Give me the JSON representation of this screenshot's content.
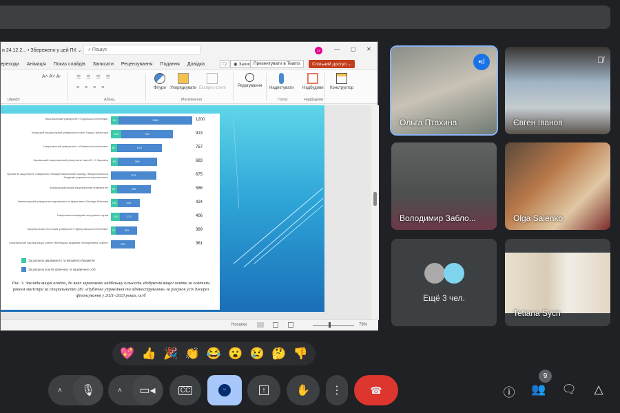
{
  "ppt": {
    "doc_title": "и 24.12.2... • Збережено у цей ПК ⌄",
    "search_placeholder": "Пошук",
    "user_initials": "CP",
    "tabs": [
      "ереходи",
      "Анімація",
      "Показ слайдів",
      "Записати",
      "Рецензування",
      "Подання",
      "Довідка"
    ],
    "record_btn": "◉ Записати",
    "present_teams_btn": "Презентувати в Teams",
    "share_btn": "Спільний доступ ⌄",
    "ribbon": {
      "groups": [
        "Шрифт",
        "Абзац",
        "Малювання",
        "Голос",
        "Надбудови"
      ],
      "buttons": [
        "Фігури",
        "Упорядкувати",
        "Експрес-стилі",
        "Редагування",
        "Надиктувати",
        "Надбудови",
        "Конструктор"
      ]
    },
    "status": {
      "notes": "Нотатки",
      "zoom": "79%"
    }
  },
  "chart_data": {
    "type": "bar",
    "orientation": "horizontal-stacked",
    "categories": [
      "Національний університет «Одеська політехніка»",
      "Київський національний університет імені Тараса Шевченка",
      "Національний університет «Львівська політехніка»",
      "Харківський національний університет імені В. Н. Каразіна",
      "Приватне акціонерне товариство «Вищий навчальний заклад «Міжрегіональна Академія управління персоналом»",
      "Західноукраїнський національний університет",
      "Хмельницький університет управління та права імені Леоніда Юзькова",
      "Національна академія внутрішніх справ",
      "Національний технічний університет «Дніпровська політехніка»",
      "Комунальний заклад вищої освіти «Вінницька академія безперервної освіти»"
    ],
    "series": [
      {
        "name": "За рахунок державного та місцевого бюджетів",
        "color": "#3cc9a8",
        "values": [
          111,
          153,
          87,
          99,
          0,
          87,
          100,
          134,
          74,
          0
        ]
      },
      {
        "name": "За рахунок коштів фізичних та юридичних осіб",
        "color": "#4a88cf",
        "values": [
          1089,
          760,
          670,
          584,
          675,
          499,
          324,
          272,
          315,
          361
        ]
      }
    ],
    "totals": [
      1200,
      913,
      757,
      683,
      675,
      586,
      424,
      406,
      389,
      361
    ],
    "caption": "Рис. 3. Заклади вищої освіти, до яких зараховано найбільшу кількість здобувачів вищої освіти за освітнім рівнем магістра за спеціальністю 281 «Публічне управління та адміністрування» за рахунок усіх джерел фінансування у 2021–2023 роках, осіб",
    "legend": "bottom-left"
  },
  "participants": [
    {
      "name": "Ольга Птахина",
      "speaking": true
    },
    {
      "name": "Євген Іванов",
      "muted": true
    },
    {
      "name": "Володимир Забло..."
    },
    {
      "name": "Olga Saienko"
    },
    {
      "name": "Tetiana Sych"
    }
  ],
  "more_participants": "Ещё 3 чел.",
  "reactions": [
    "💖",
    "👍",
    "🎉",
    "👏",
    "😂",
    "😮",
    "😢",
    "🤔",
    "👎"
  ],
  "participant_count": "9"
}
